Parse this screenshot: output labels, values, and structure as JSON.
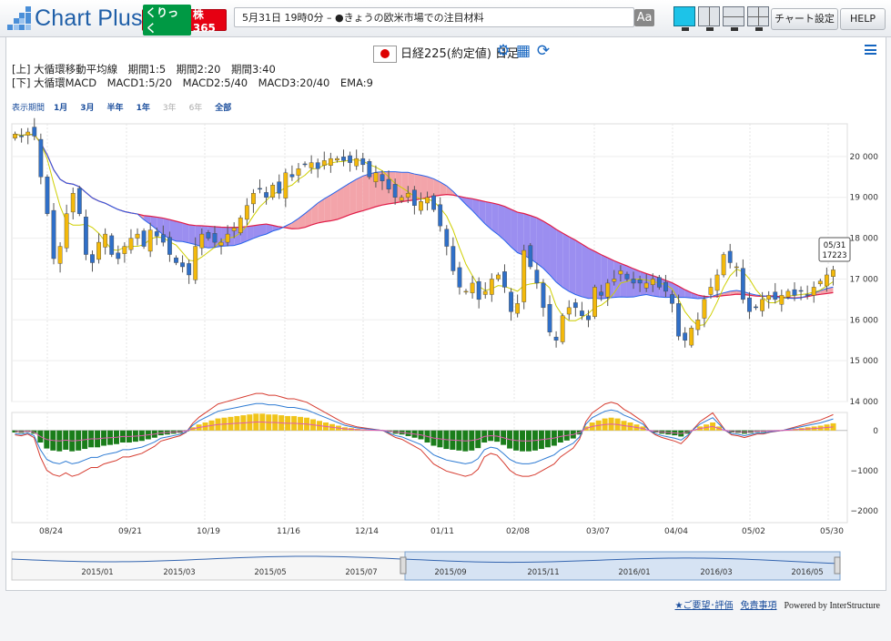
{
  "app": {
    "name": "Chart Plus",
    "brand": {
      "green": "くりっく",
      "main": "株365"
    }
  },
  "news": {
    "text": "5月31日 19時0分 – ●きょうの欧米市場での注目材料",
    "font_button": "Aa"
  },
  "layout_buttons": [
    "layout-single",
    "layout-two-columns",
    "layout-two-rows",
    "layout-four-grid"
  ],
  "buttons": {
    "chart_settings": "チャート設定",
    "help": "HELP"
  },
  "chart_title": "日経225(約定値) 日足",
  "toolbar_icons": [
    "gear-icon",
    "table-icon",
    "refresh-icon"
  ],
  "indicators": {
    "upper": "[上] 大循環移動平均線　期間1:5　期間2:20　期間3:40",
    "lower": "[下] 大循環MACD　MACD1:5/20　MACD2:5/40　MACD3:20/40　EMA:9"
  },
  "periods": {
    "label": "表示期間",
    "items": [
      {
        "t": "1月",
        "on": true
      },
      {
        "t": "3月",
        "on": true
      },
      {
        "t": "半年",
        "on": true
      },
      {
        "t": "1年",
        "on": true
      },
      {
        "t": "3年",
        "on": false
      },
      {
        "t": "6年",
        "on": false
      },
      {
        "t": "全部",
        "on": true
      }
    ]
  },
  "colors": {
    "up": "#f3b90b",
    "down": "#2f6fc8",
    "ma5": "#cfcf00",
    "ma20": "#2563eb",
    "ma40": "#e11d48",
    "cloud_bull": "#f3a4aa",
    "cloud_bear": "#9b8ef0",
    "hist_pos": "#f0c419",
    "hist_neg": "#1a7d1a"
  },
  "chart_data": {
    "type": "candlestick",
    "price_axis": {
      "ticks": [
        20000,
        19000,
        18000,
        17000,
        16000,
        15000,
        14000
      ],
      "tick_labels": [
        "20 000",
        "19 000",
        "18 000",
        "17 000",
        "16 000",
        "15 000",
        "14 000"
      ]
    },
    "macd_axis": {
      "ticks": [
        0,
        -1000,
        -2000
      ],
      "tick_labels": [
        "0",
        "−1000",
        "−2000"
      ]
    },
    "x_labels": [
      "08/24",
      "09/21",
      "10/19",
      "11/16",
      "12/14",
      "01/11",
      "02/08",
      "03/07",
      "04/04",
      "05/02",
      "05/30"
    ],
    "last_price": {
      "date": "05/31",
      "value": "17223"
    },
    "navigator_labels": [
      "2015/01",
      "2015/03",
      "2015/05",
      "2015/07",
      "2015/09",
      "2015/11",
      "2016/01",
      "2016/03",
      "2016/05"
    ],
    "closes": [
      20550,
      20480,
      20600,
      20500,
      19500,
      18600,
      17500,
      17800,
      18600,
      19100,
      18600,
      17600,
      17400,
      17900,
      18100,
      17600,
      17500,
      17800,
      18000,
      18100,
      17800,
      18200,
      18050,
      17900,
      17600,
      17400,
      17300,
      17100,
      17800,
      18100,
      18000,
      17900,
      17900,
      18100,
      18250,
      18500,
      18800,
      19100,
      19200,
      19000,
      19300,
      19100,
      19600,
      19500,
      19700,
      19800,
      19850,
      19700,
      19900,
      19950,
      19950,
      19900,
      19850,
      19950,
      19800,
      19500,
      19600,
      19400,
      19200,
      19000,
      19000,
      19100,
      18800,
      18900,
      19000,
      18700,
      18300,
      17800,
      17200,
      16800,
      16700,
      16900,
      16500,
      16700,
      17000,
      17100,
      16800,
      16200,
      16400,
      17700,
      17300,
      16900,
      16300,
      15700,
      15500,
      16100,
      16300,
      16300,
      16100,
      16000,
      16800,
      16600,
      16900,
      17000,
      17200,
      17000,
      16900,
      16900,
      16900,
      17000,
      16800,
      16700,
      16400,
      15600,
      15500,
      15800,
      16000,
      16500,
      16800,
      17100,
      17600,
      17400,
      17300,
      16500,
      16200,
      16300,
      16500,
      16600,
      16500,
      16600,
      16700,
      16600,
      16700,
      16600,
      16800,
      16950,
      17100,
      17223
    ],
    "macd_hist": [
      -50,
      -60,
      -40,
      -80,
      -300,
      -450,
      -500,
      -520,
      -480,
      -520,
      -500,
      -460,
      -420,
      -420,
      -380,
      -360,
      -340,
      -300,
      -300,
      -280,
      -260,
      -220,
      -180,
      -120,
      -100,
      -80,
      -60,
      -20,
      80,
      150,
      200,
      250,
      300,
      320,
      340,
      360,
      380,
      400,
      420,
      420,
      400,
      400,
      380,
      360,
      360,
      340,
      320,
      280,
      240,
      200,
      160,
      120,
      80,
      60,
      40,
      30,
      20,
      10,
      0,
      -40,
      -80,
      -100,
      -140,
      -180,
      -220,
      -300,
      -380,
      -420,
      -460,
      -480,
      -500,
      -520,
      -500,
      -440,
      -300,
      -260,
      -280,
      -360,
      -450,
      -500,
      -520,
      -520,
      -500,
      -460,
      -420,
      -380,
      -300,
      -250,
      -200,
      -100,
      100,
      200,
      250,
      300,
      320,
      300,
      240,
      200,
      150,
      100,
      0,
      -50,
      -80,
      -100,
      -120,
      -150,
      -80,
      20,
      100,
      150,
      200,
      100,
      0,
      -50,
      -60,
      -80,
      -60,
      -40,
      -40,
      -20,
      -10,
      0,
      20,
      40,
      60,
      80,
      100,
      120,
      150,
      180
    ]
  }
}
